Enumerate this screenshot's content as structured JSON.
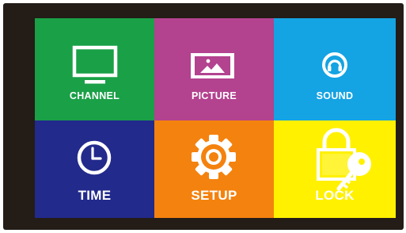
{
  "menu": {
    "tiles": [
      {
        "label": "CHANNEL",
        "color": "#1aa047",
        "icon": "tv-icon"
      },
      {
        "label": "PICTURE",
        "color": "#b3428f",
        "icon": "picture-icon"
      },
      {
        "label": "SOUND",
        "color": "#14a3e3",
        "icon": "headphones-icon"
      },
      {
        "label": "TIME",
        "color": "#222a8c",
        "icon": "clock-icon"
      },
      {
        "label": "SETUP",
        "color": "#f4820e",
        "icon": "gear-icon"
      },
      {
        "label": "LOCK",
        "color": "#fff100",
        "icon": "lock-key-icon"
      }
    ]
  }
}
